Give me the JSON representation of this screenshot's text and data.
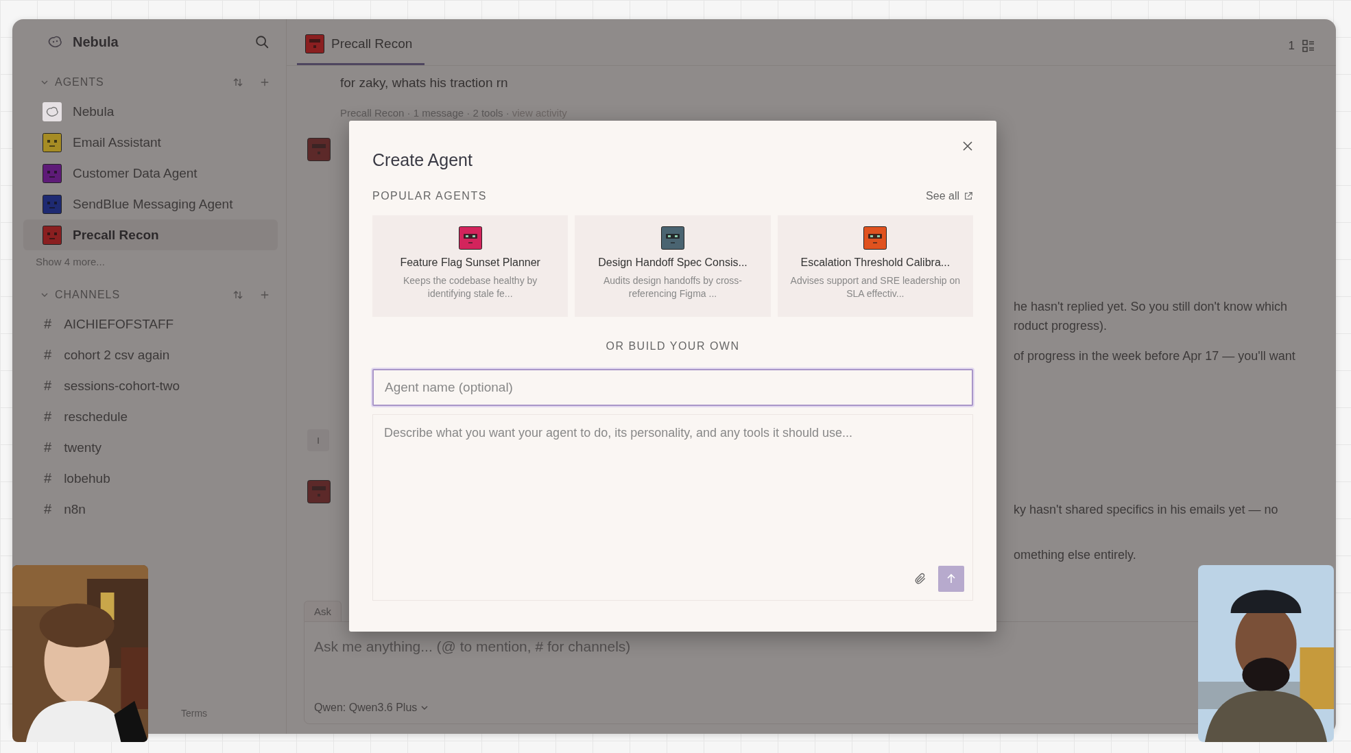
{
  "app": {
    "name": "Nebula"
  },
  "sidebar": {
    "agents_section": {
      "title": "AGENTS",
      "expanded": true
    },
    "agents": [
      {
        "name": "Nebula",
        "kind": "logo",
        "selected": false
      },
      {
        "name": "Email Assistant",
        "kind": "avatar",
        "color": "#a68c24",
        "selected": false
      },
      {
        "name": "Customer Data Agent",
        "kind": "avatar",
        "color": "#5e1b78",
        "selected": false
      },
      {
        "name": "SendBlue Messaging Agent",
        "kind": "avatar",
        "color": "#1e2a72",
        "selected": false
      },
      {
        "name": "Precall Recon",
        "kind": "avatar",
        "color": "#8a1f20",
        "selected": true
      }
    ],
    "show_more": "Show 4 more...",
    "channels_section": {
      "title": "CHANNELS",
      "expanded": true
    },
    "channels": [
      {
        "prefix": "#",
        "name": "AICHIEFOFSTAFF"
      },
      {
        "prefix": "#",
        "name": "cohort 2 csv again"
      },
      {
        "prefix": "#",
        "name": "sessions-cohort-two"
      },
      {
        "prefix": "#",
        "name": "reschedule"
      },
      {
        "prefix": "#",
        "name": "twenty"
      },
      {
        "prefix": "#",
        "name": "lobehub"
      },
      {
        "prefix": "#",
        "name": "n8n"
      }
    ],
    "footer_links": [
      "Terms"
    ]
  },
  "tab": {
    "label": "Precall Recon",
    "selected": true,
    "color": "#8a1f20"
  },
  "topbar": {
    "count": "1"
  },
  "chat": {
    "rows": [
      {
        "text": "for zaky, whats his traction rn",
        "kind": "message"
      },
      {
        "text": "Precall Recon · 1 message · 2 tools ·",
        "link": "view activity",
        "kind": "meta"
      },
      {
        "kind": "agent_avatar"
      },
      {
        "text": "he hasn't replied yet. So you still don't know which",
        "kind": "fragment"
      },
      {
        "text": "roduct progress).",
        "kind": "fragment"
      },
      {
        "text": "of progress in the week before Apr 17 — you'll want",
        "kind": "fragment"
      },
      {
        "initial": "I",
        "kind": "user_avatar"
      },
      {
        "text": "ky hasn't shared specifics in his emails yet — no",
        "kind": "agent_fragment"
      },
      {
        "text": "omething else entirely.",
        "kind": "fragment"
      }
    ]
  },
  "composer": {
    "tab": "Ask",
    "placeholder": "Ask me anything... (@ to mention, # for channels)",
    "model": "Qwen: Qwen3.6 Plus"
  },
  "modal": {
    "title": "Create Agent",
    "popular_heading": "POPULAR AGENTS",
    "see_all": "See all",
    "agents": [
      {
        "name": "Feature Flag Sunset Planner",
        "description": "Keeps the codebase healthy by identifying stale fe...",
        "color": "#d3245c"
      },
      {
        "name": "Design Handoff Spec Consis...",
        "description": "Audits design handoffs by cross-referencing Figma ...",
        "color": "#4a6471"
      },
      {
        "name": "Escalation Threshold Calibra...",
        "description": "Advises support and SRE leadership on SLA effectiv...",
        "color": "#e0521f"
      }
    ],
    "divider_label": "OR BUILD YOUR OWN",
    "name_field": {
      "placeholder": "Agent name (optional)",
      "focused": true
    },
    "description_field": {
      "placeholder": "Describe what you want your agent to do, its personality, and any tools it should use..."
    }
  }
}
